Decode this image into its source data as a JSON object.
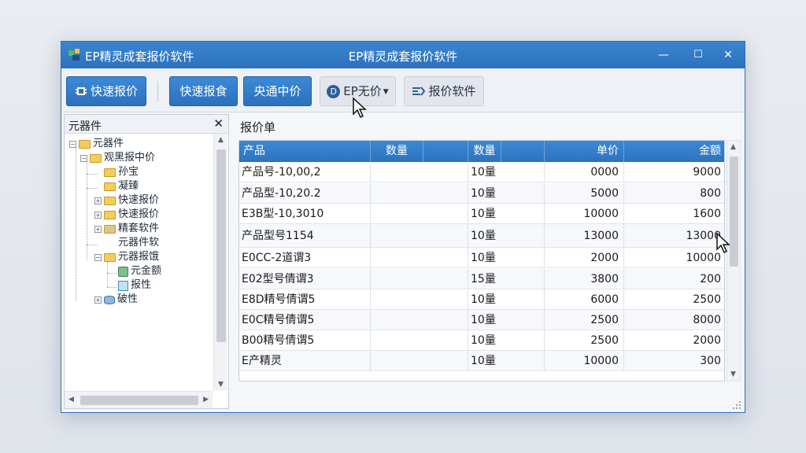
{
  "window": {
    "app_name": "EP精灵成套报价软件",
    "title": "EP精灵成套报价软件",
    "controls": {
      "minimize": "—",
      "maximize": "☐",
      "close": "✕"
    }
  },
  "toolbar": {
    "btn1": "快速报价",
    "btn2": "快速报食",
    "btn3": "央通中价",
    "btn4": "EP无价",
    "btn4_badge": "D",
    "btn5": "报价软件"
  },
  "left_panel": {
    "title": "元器件",
    "close": "✕",
    "tree": [
      {
        "label": "元器件",
        "expander": "−"
      },
      {
        "label": "观黑报中价",
        "expander": "−"
      },
      {
        "label": "孙宝"
      },
      {
        "label": "凝臻"
      },
      {
        "label": "快速报价",
        "expander": "+"
      },
      {
        "label": "快速报价",
        "expander": "+"
      },
      {
        "label": "精套软件",
        "expander": "+"
      },
      {
        "label": "元器件软"
      },
      {
        "label": "元器报饿",
        "expander": "−"
      },
      {
        "label": "元金额"
      },
      {
        "label": "报性"
      },
      {
        "label": "破性",
        "expander": "+"
      }
    ]
  },
  "quote": {
    "label": "报价单",
    "columns": [
      "产品",
      "数量",
      "数量",
      "单价",
      "金额"
    ],
    "rows": [
      [
        "产品号-10,00,2",
        "",
        "10量",
        "0000",
        "9000"
      ],
      [
        "产品型-10,20.2",
        "",
        "10量",
        "5000",
        "800"
      ],
      [
        "E3B型-10,3010",
        "",
        "10量",
        "10000",
        "1600"
      ],
      [
        "产品型号1154",
        "",
        "10量",
        "13000",
        "13000"
      ],
      [
        "E0CC-2道谓3",
        "",
        "10量",
        "2000",
        "10000"
      ],
      [
        "E02型号倩谓3",
        "",
        "15量",
        "3800",
        "200"
      ],
      [
        "E8D精号倩谓5",
        "",
        "10量",
        "6000",
        "2500"
      ],
      [
        "E0C精号倩谓5",
        "",
        "10量",
        "2500",
        "8000"
      ],
      [
        "B00精号倩谓5",
        "",
        "10量",
        "2500",
        "2000"
      ],
      [
        "E产精灵",
        "",
        "10量",
        "10000",
        "300"
      ]
    ]
  }
}
